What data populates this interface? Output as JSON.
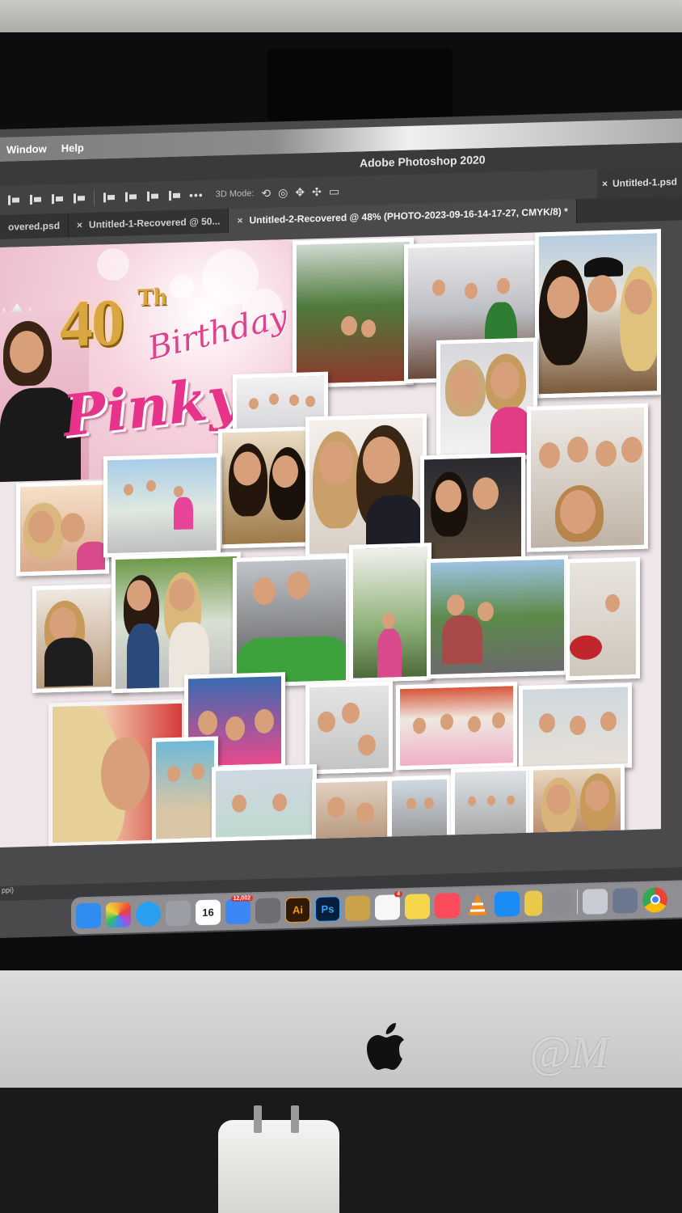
{
  "menubar": {
    "items": [
      "Window",
      "Help"
    ]
  },
  "app": {
    "title": "Adobe Photoshop 2020"
  },
  "options_bar": {
    "more": "•••",
    "mode_label": "3D Mode:",
    "mode_icons": [
      "orbit-icon",
      "roll-icon",
      "pan-icon",
      "slide-icon",
      "scale-camera-icon"
    ],
    "right_tab": {
      "close": "×",
      "label": "Untitled-1.psd"
    }
  },
  "tabs": [
    {
      "label": "overed.psd",
      "close": ""
    },
    {
      "label": "Untitled-1-Recovered @ 50...",
      "close": "×"
    },
    {
      "label": "Untitled-2-Recovered @ 48% (PHOTO-2023-09-16-14-17-27, CMYK/8) *",
      "close": "×",
      "active": true
    }
  ],
  "statusbar": {
    "text": "ppi)"
  },
  "collage": {
    "number": "40",
    "ordinal": "Th",
    "subtitle": "Birthday",
    "name": "Pinky"
  },
  "dock": {
    "apps": [
      {
        "name": "finder-icon",
        "color": "#2f8cf0"
      },
      {
        "name": "photos-icon",
        "color": "#f29a3a"
      },
      {
        "name": "safari-icon",
        "color": "#2a9ff0"
      },
      {
        "name": "launchpad-icon",
        "color": "#9b9ea5"
      },
      {
        "name": "calendar-icon",
        "color": "#ffffff",
        "text": "16",
        "text_color": "#222"
      },
      {
        "name": "mail-icon",
        "color": "#3b87f5",
        "badge": "12,002"
      },
      {
        "name": "calculator-icon",
        "color": "#6e6e72"
      },
      {
        "name": "illustrator-icon",
        "color": "#2e1a05",
        "text": "Ai",
        "text_color": "#ff9a00"
      },
      {
        "name": "photoshop-icon",
        "color": "#061e3a",
        "text": "Ps",
        "text_color": "#31a8ff"
      },
      {
        "name": "keychain-icon",
        "color": "#c9a24a"
      },
      {
        "name": "reminders-icon",
        "color": "#f7f7f7",
        "badge": "4"
      },
      {
        "name": "notes-icon",
        "color": "#f6d64b"
      },
      {
        "name": "music-icon",
        "color": "#fb4a5a"
      },
      {
        "name": "vlc-icon",
        "color": "#f28a1b"
      },
      {
        "name": "app-store-icon",
        "color": "#1b8bf5"
      },
      {
        "name": "stickies-icon",
        "color": "#e9c84a"
      },
      {
        "name": "system-preferences-icon",
        "color": "#8a8c92"
      },
      {
        "name": "preview-icon",
        "color": "#c8ccd4"
      },
      {
        "name": "image-capture-icon",
        "color": "#6c7890"
      },
      {
        "name": "chrome-icon",
        "color": "#ffffff"
      }
    ]
  },
  "chin": {
    "reflection_text": "@M"
  }
}
